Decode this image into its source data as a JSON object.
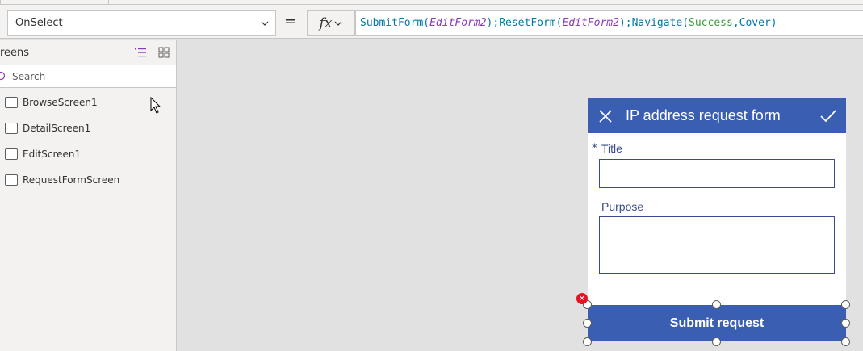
{
  "formula_bar": {
    "property": "OnSelect",
    "equals": "=",
    "fx_label": "fx",
    "formula": [
      {
        "t": "fn",
        "v": "SubmitForm("
      },
      {
        "t": "ctl",
        "v": "EditForm2"
      },
      {
        "t": "fn",
        "v": ");"
      },
      {
        "t": "plain",
        "v": " "
      },
      {
        "t": "fn",
        "v": "ResetForm("
      },
      {
        "t": "ctl",
        "v": "EditForm2"
      },
      {
        "t": "fn",
        "v": ");Navigate("
      },
      {
        "t": "enum",
        "v": "Success"
      },
      {
        "t": "fn",
        "v": ",Cover)"
      }
    ]
  },
  "left_panel": {
    "title": "reens",
    "search_placeholder": "Search",
    "screens": [
      "BrowseScreen1",
      "DetailScreen1",
      "EditScreen1",
      "RequestFormScreen"
    ]
  },
  "form": {
    "title": "IP address request form",
    "required_mark": "*",
    "field1_label": "Title",
    "field2_label": "Purpose",
    "submit_label": "Submit request",
    "error_glyph": "✕"
  },
  "colors": {
    "header": "#3a5fb2",
    "label": "#3a4a8c",
    "error": "#e81123"
  }
}
